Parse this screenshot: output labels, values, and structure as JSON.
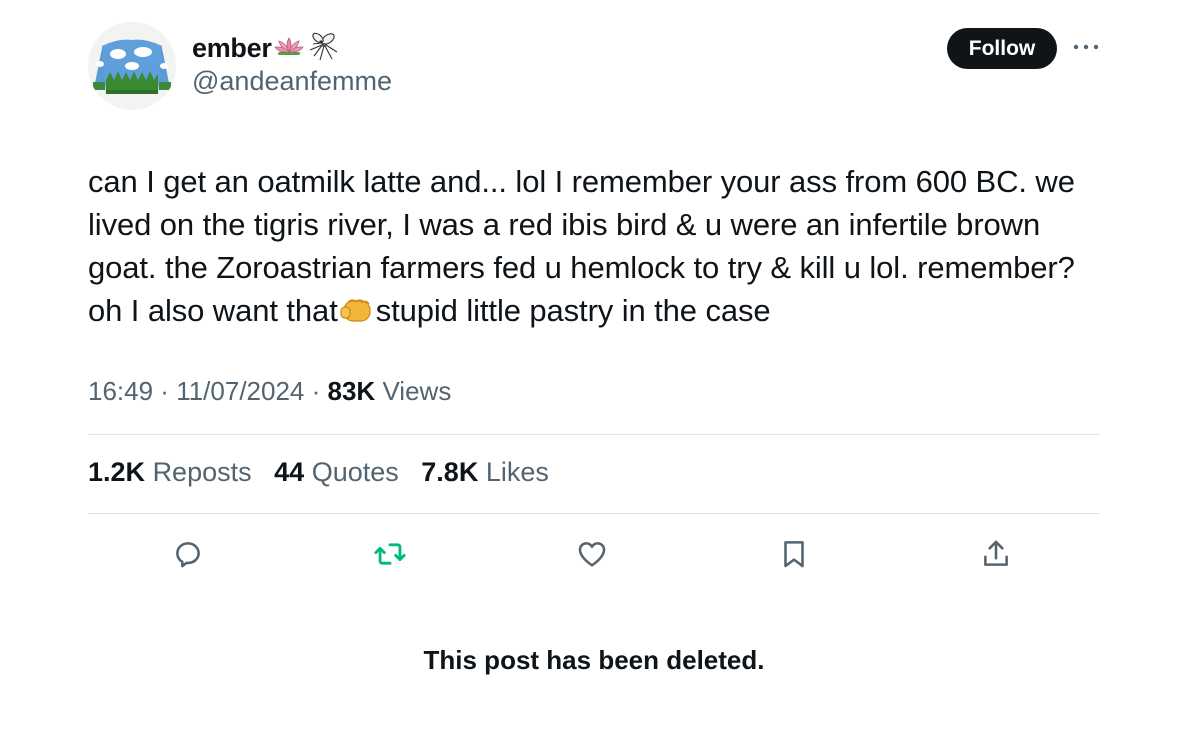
{
  "author": {
    "name": "ember",
    "handle": "@andeanfemme"
  },
  "follow_label": "Follow",
  "tweet": {
    "text_part1": "can I get an oatmilk latte and... lol I remember your ass from 600 BC. we lived on the tigris river, I was a red ibis bird & u were an infertile brown goat. the Zoroastrian farmers fed u hemlock to try & kill u lol. remember? oh I also want that",
    "text_part2": "stupid little pastry in the case",
    "time": "16:49",
    "date": "11/07/2024",
    "views_count": "83K",
    "views_label": "Views"
  },
  "stats": {
    "reposts_count": "1.2K",
    "reposts_label": "Reposts",
    "quotes_count": "44",
    "quotes_label": "Quotes",
    "likes_count": "7.8K",
    "likes_label": "Likes"
  },
  "actions": [
    "reply-icon",
    "repost-icon",
    "like-icon",
    "bookmark-icon",
    "share-icon"
  ],
  "colors": {
    "text": "#0f1419",
    "secondary": "#536471",
    "repost_green": "#00ba7c",
    "divider": "#dfe3e7"
  },
  "notice": "This post has been deleted."
}
